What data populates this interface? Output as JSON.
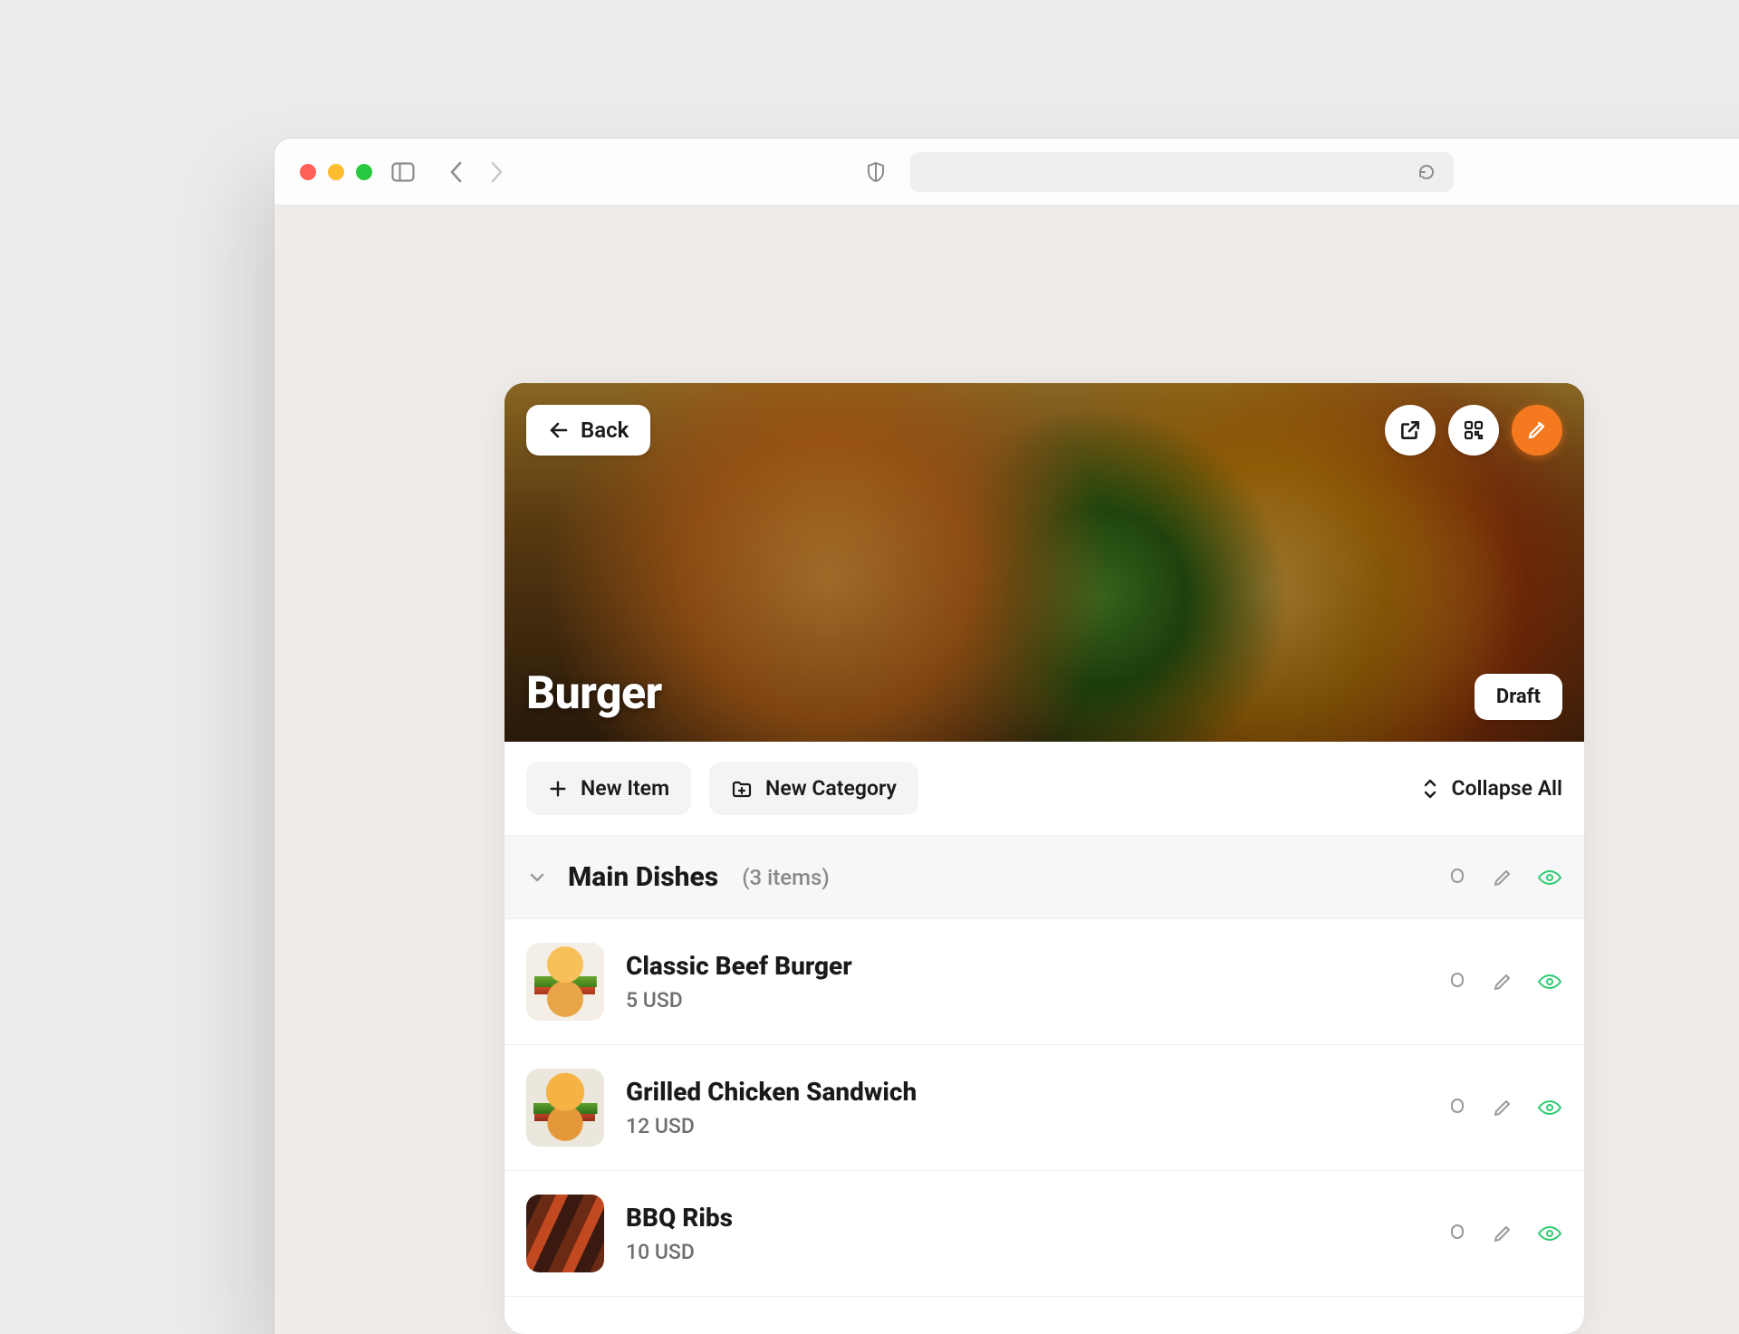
{
  "hero": {
    "back_label": "Back",
    "title": "Burger",
    "status": "Draft"
  },
  "toolbar": {
    "new_item_label": "New Item",
    "new_category_label": "New Category",
    "collapse_label": "Collapse All"
  },
  "category": {
    "name": "Main Dishes",
    "count_label": "(3 items)"
  },
  "items": [
    {
      "name": "Classic Beef Burger",
      "price": "5 USD"
    },
    {
      "name": "Grilled Chicken Sandwich",
      "price": "12 USD"
    },
    {
      "name": "BBQ Ribs",
      "price": "10 USD"
    }
  ],
  "colors": {
    "accent": "#f57a1f",
    "success": "#2ecc71"
  }
}
